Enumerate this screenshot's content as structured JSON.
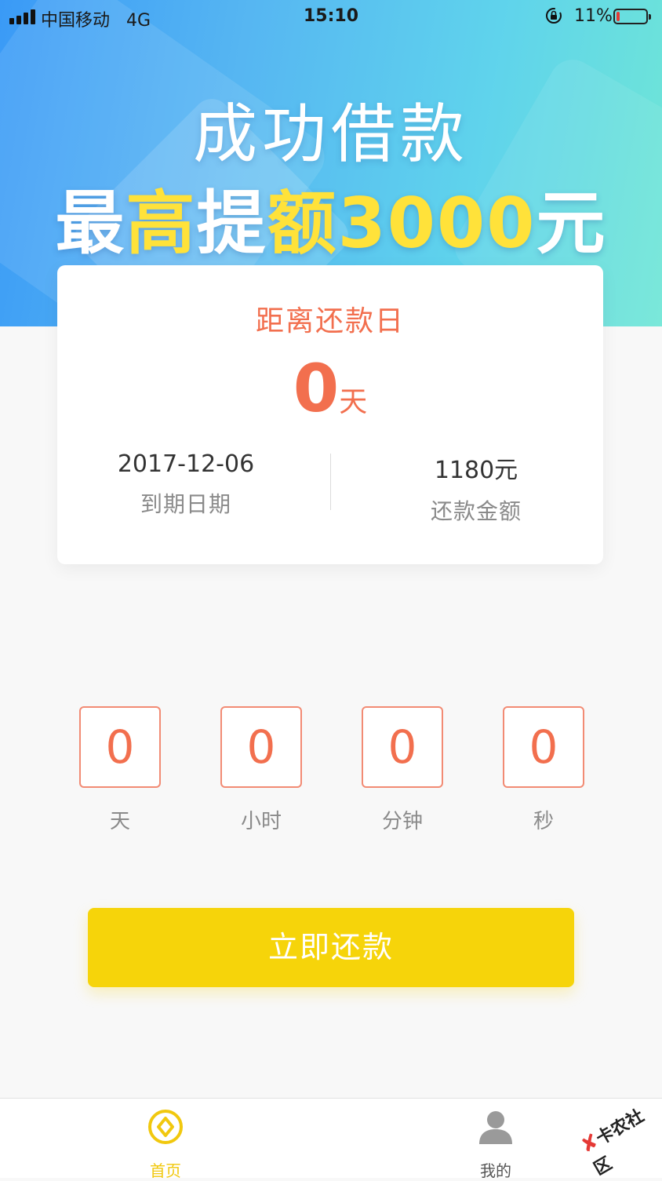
{
  "status_bar": {
    "carrier": "中国移动",
    "network": "4G",
    "time": "15:10",
    "battery_percent": "11%",
    "battery_level": 0.11
  },
  "banner": {
    "line1": "成功借款",
    "line2_prefix": "最",
    "line2_hl1": "高",
    "line2_mid": "提",
    "line2_hl2": "额",
    "line2_amount": "3000",
    "line2_suffix": "元"
  },
  "card": {
    "title": "距离还款日",
    "days_value": "0",
    "days_unit": "天",
    "due_date_value": "2017-12-06",
    "due_date_label": "到期日期",
    "amount_value": "1180元",
    "amount_label": "还款金额"
  },
  "countdown": [
    {
      "value": "0",
      "label": "天"
    },
    {
      "value": "0",
      "label": "小时"
    },
    {
      "value": "0",
      "label": "分钟"
    },
    {
      "value": "0",
      "label": "秒"
    }
  ],
  "repay_button": "立即还款",
  "tabbar": {
    "home_label": "首页",
    "mine_label": "我的"
  },
  "watermark": {
    "text": "卡农社区"
  },
  "colors": {
    "accent": "#f26f4e",
    "button": "#f6d40a",
    "tab_active": "#f1c80e"
  },
  "icons": [
    "signal-icon",
    "rotation-lock-icon",
    "battery-icon",
    "home-coin-icon",
    "profile-icon"
  ]
}
